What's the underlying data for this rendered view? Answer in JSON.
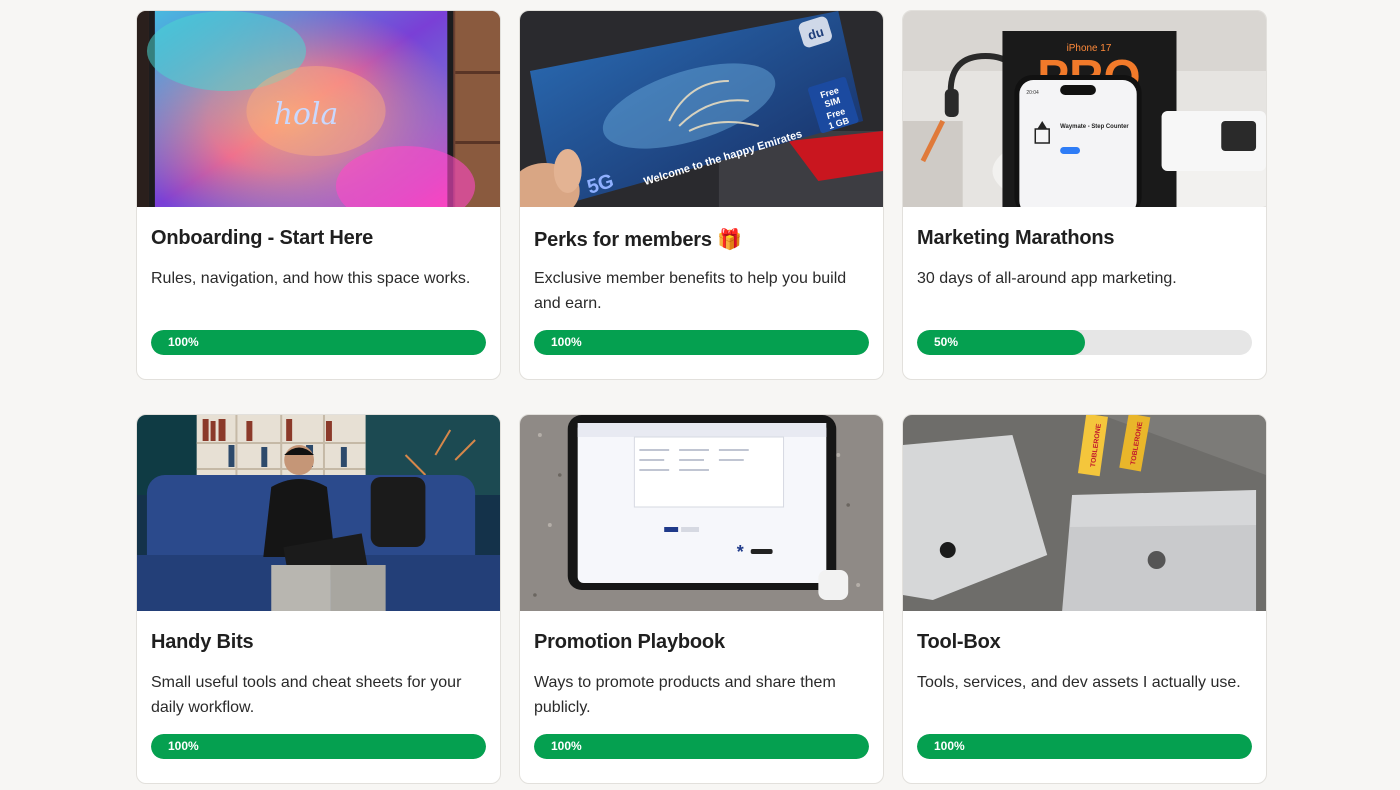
{
  "courses": [
    {
      "title": "Onboarding - Start Here",
      "description": "Rules, navigation, and how this space works.",
      "progress": 100,
      "progress_label": "100%",
      "image": {
        "kind": "tablet-gradient",
        "text": "hola"
      }
    },
    {
      "title": "Perks for members 🎁",
      "description": "Exclusive member benefits to help you build and earn.",
      "progress": 100,
      "progress_label": "100%",
      "image": {
        "kind": "sim-card",
        "brand": "du",
        "badge_top": "Free SIM",
        "badge_bottom": "Free 1 GB",
        "network": "5G",
        "text": "Welcome to the happy Emirates"
      }
    },
    {
      "title": "Marketing Marathons",
      "description": "30 days of all-around app marketing.",
      "progress": 50,
      "progress_label": "50%",
      "image": {
        "kind": "phone-store",
        "poster_text": "PRO",
        "poster_small": "iPhone 17",
        "app_name": "Waymate - Step Counter"
      }
    },
    {
      "title": "Handy Bits",
      "description": "Small useful tools and cheat sheets for your daily workflow.",
      "progress": 100,
      "progress_label": "100%",
      "image": {
        "kind": "man-laptop-sofa"
      }
    },
    {
      "title": "Promotion Playbook",
      "description": "Ways to promote products and share them publicly.",
      "progress": 100,
      "progress_label": "100%",
      "image": {
        "kind": "tablet-on-table"
      }
    },
    {
      "title": "Tool-Box",
      "description": "Tools, services, and dev assets I actually use.",
      "progress": 100,
      "progress_label": "100%",
      "image": {
        "kind": "laptops-chocolate",
        "brand_text": "TOBLERONE"
      }
    }
  ],
  "colors": {
    "progress_fill": "#05a050",
    "progress_track": "#e6e6e6",
    "card_bg": "#ffffff",
    "page_bg": "#f7f6f4"
  }
}
